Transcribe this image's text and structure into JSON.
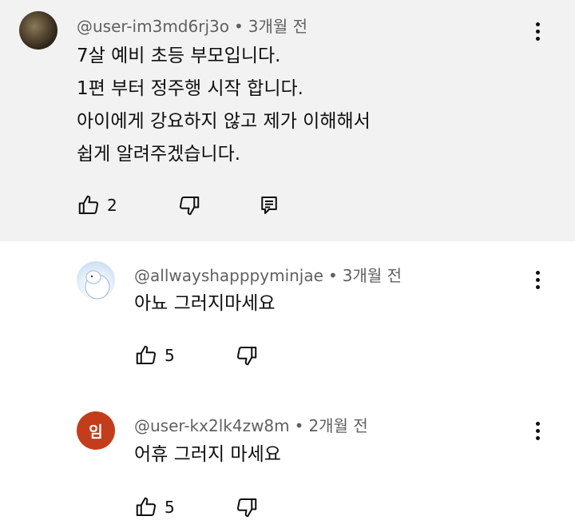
{
  "comments": [
    {
      "author": "@user-im3md6rj3o",
      "separator": "•",
      "time": "3개월 전",
      "lines": [
        "7살 예비 초등 부모입니다.",
        "1편 부터 정주행 시작 합니다.",
        "아이에게 강요하지 않고 제가 이해해서",
        "쉽게 알려주겠습니다."
      ],
      "likes": "2",
      "avatar": "photo-avatar",
      "actions": [
        "like-icon",
        "dislike-icon",
        "reply-icon"
      ]
    }
  ],
  "replies": [
    {
      "author": "@allwayshapppyminjae",
      "separator": "•",
      "time": "3개월 전",
      "text": "아뇨 그러지마세요",
      "likes": "5",
      "avatar": "illustration-avatar"
    },
    {
      "author": "@user-kx2lk4zw8m",
      "separator": "•",
      "time": "2개월 전",
      "text": "어휴 그러지 마세요",
      "likes": "5",
      "avatar_letter": "임",
      "avatar_color": "#c43d1a"
    }
  ],
  "colors": {
    "top_comment_bg": "#f2f2f2",
    "meta_text": "#606060",
    "text": "#0f0f0f"
  },
  "icons": {
    "more": "more-vert-icon",
    "like": "thumb-up-icon",
    "dislike": "thumb-down-icon",
    "reply": "reply-icon"
  }
}
